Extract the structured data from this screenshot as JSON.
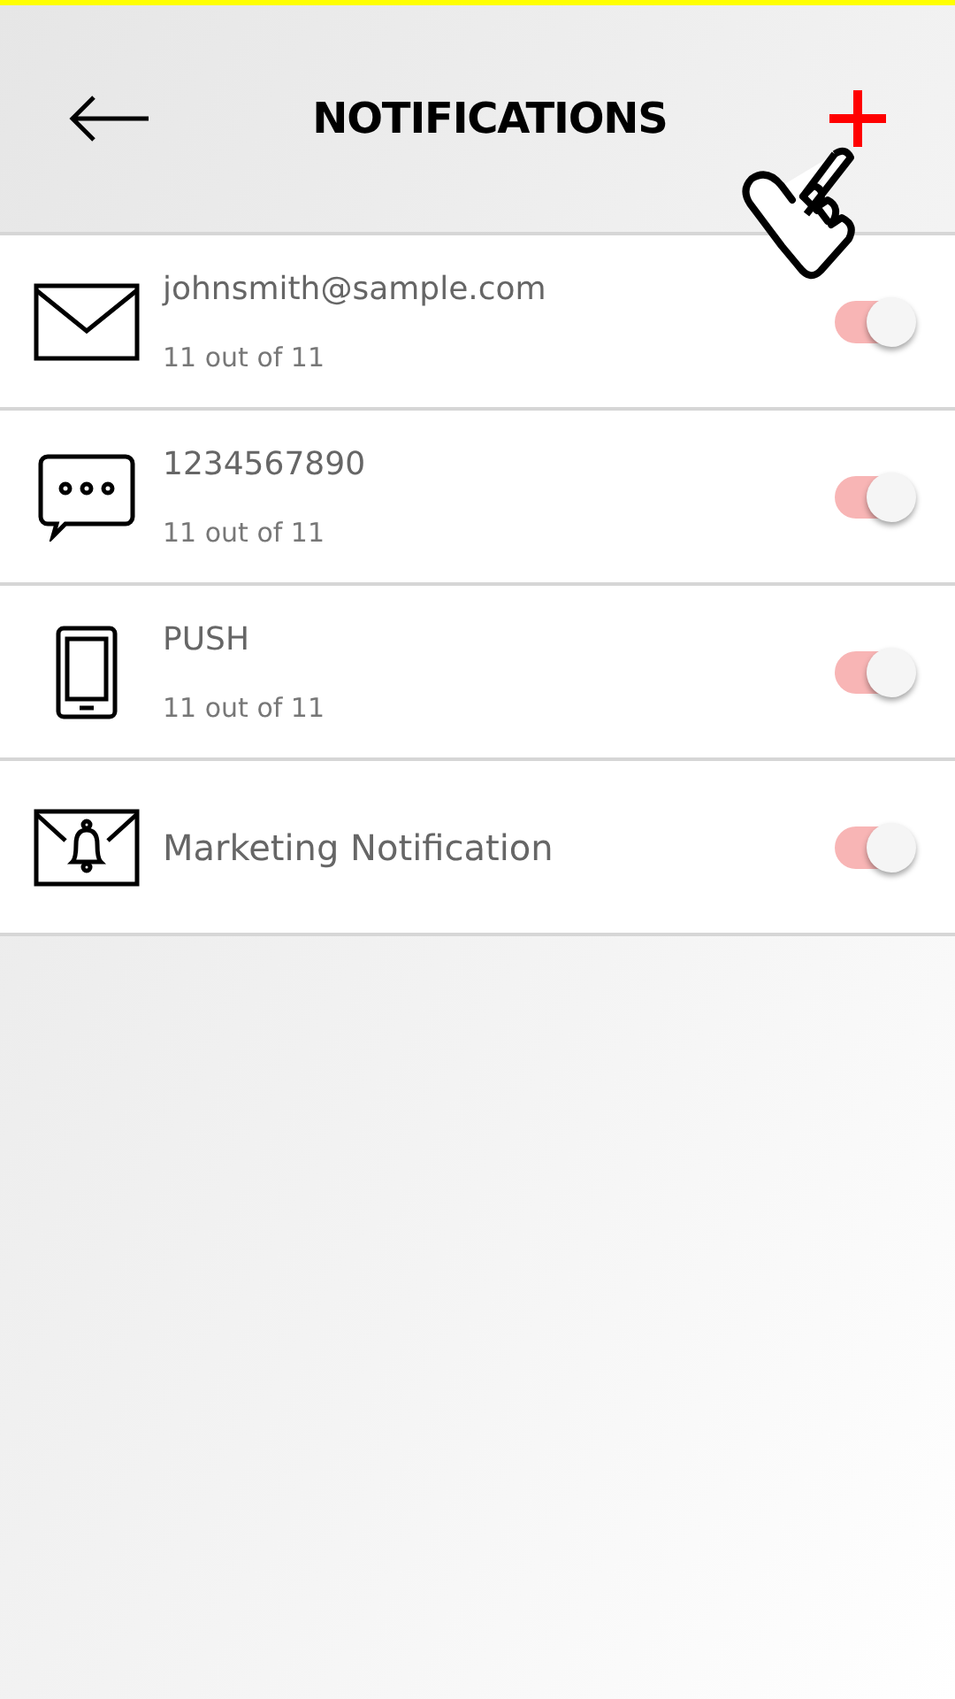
{
  "header": {
    "title": "NOTIFICATIONS"
  },
  "channels": [
    {
      "kind": "email",
      "name": "johnsmith@sample.com",
      "count": "11 out of 11",
      "on": true
    },
    {
      "kind": "sms",
      "name": "1234567890",
      "count": "11 out of 11",
      "on": true
    },
    {
      "kind": "push",
      "name": "PUSH",
      "count": "11 out of 11",
      "on": true
    },
    {
      "kind": "marketing",
      "name": "Marketing Notification",
      "on": true
    }
  ]
}
